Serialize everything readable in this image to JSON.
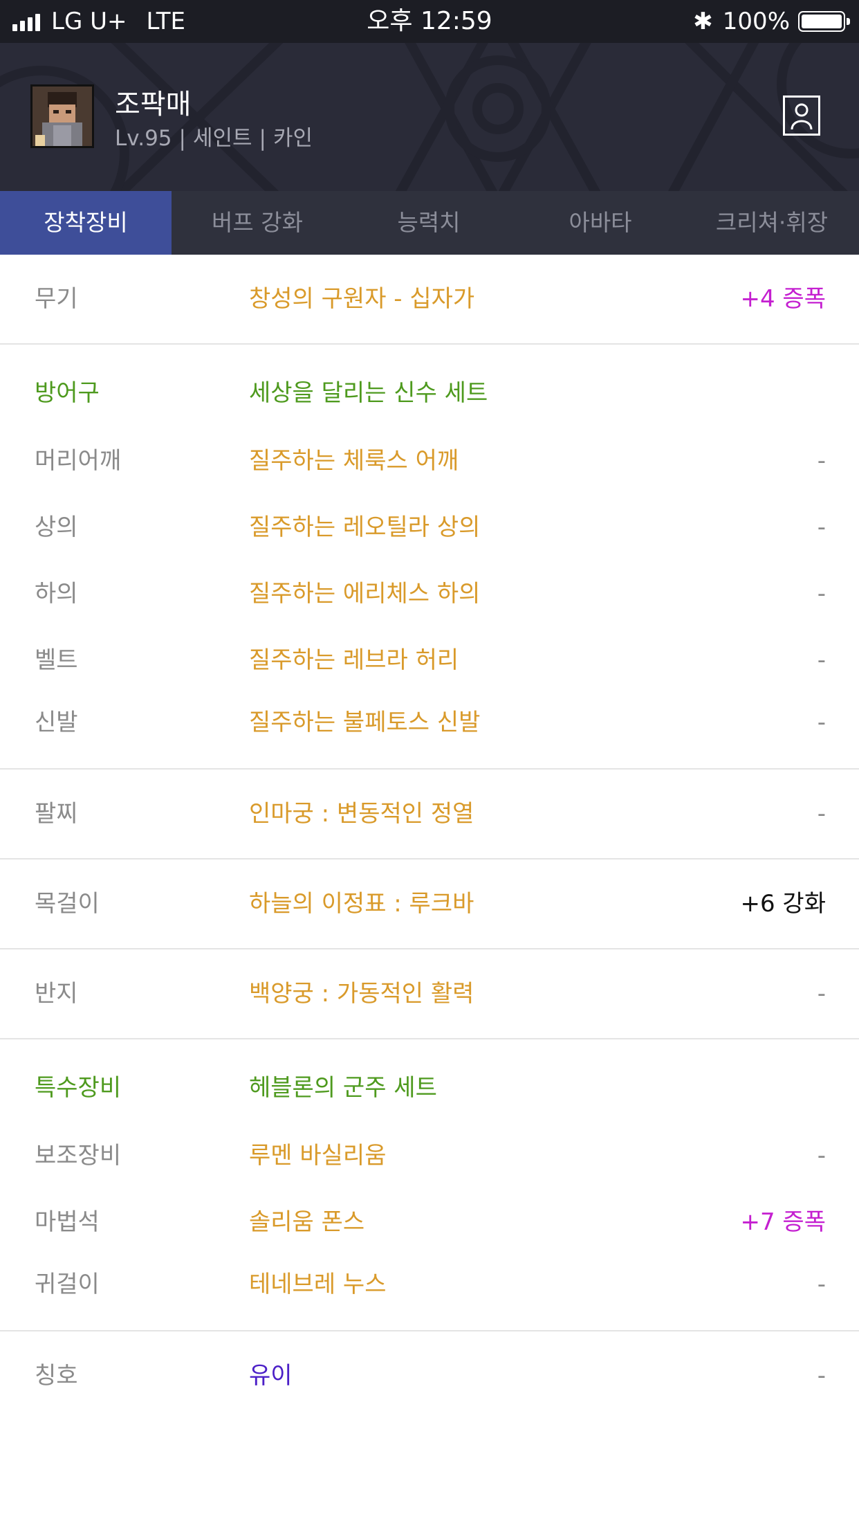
{
  "status_bar": {
    "carrier": "LG U+",
    "network": "LTE",
    "time": "오후 12:59",
    "battery": "100%",
    "icons": [
      "signal-icon",
      "bluetooth-icon",
      "battery-icon"
    ]
  },
  "profile": {
    "name": "조팍매",
    "level": "Lv.95",
    "server": "세인트",
    "job": "카인",
    "avatar_icon": "character-portrait",
    "profile_button_icon": "person-card-icon"
  },
  "tabs": [
    {
      "label": "장착장비",
      "active": true
    },
    {
      "label": "버프 강화",
      "active": false
    },
    {
      "label": "능력치",
      "active": false
    },
    {
      "label": "아바타",
      "active": false
    },
    {
      "label": "크리쳐·휘장",
      "active": false
    }
  ],
  "equipment": {
    "weapon": {
      "slot": "무기",
      "item": "창성의 구원자 - 십자가",
      "value": "+4 증폭"
    },
    "armor": {
      "header": {
        "slot": "방어구",
        "item": "세상을 달리는 신수 세트"
      },
      "items": [
        {
          "slot": "머리어깨",
          "item": "질주하는 체룩스 어깨",
          "value": "-"
        },
        {
          "slot": "상의",
          "item": "질주하는 레오틸라 상의",
          "value": "-"
        },
        {
          "slot": "하의",
          "item": "질주하는 에리체스 하의",
          "value": "-"
        },
        {
          "slot": "벨트",
          "item": "질주하는 레브라 허리",
          "value": "-"
        },
        {
          "slot": "신발",
          "item": "질주하는 불페토스 신발",
          "value": "-"
        }
      ]
    },
    "bracelet": {
      "slot": "팔찌",
      "item": "인마궁 : 변동적인 정열",
      "value": "-"
    },
    "necklace": {
      "slot": "목걸이",
      "item": "하늘의 이정표 : 루크바",
      "value": "+6 강화"
    },
    "ring": {
      "slot": "반지",
      "item": "백양궁 : 가동적인 활력",
      "value": "-"
    },
    "special": {
      "header": {
        "slot": "특수장비",
        "item": "헤블론의 군주 세트"
      },
      "items": [
        {
          "slot": "보조장비",
          "item": "루멘 바실리움",
          "value": "-"
        },
        {
          "slot": "마법석",
          "item": "솔리움 폰스",
          "value": "+7 증폭"
        },
        {
          "slot": "귀걸이",
          "item": "테네브레 누스",
          "value": "-"
        }
      ]
    },
    "title": {
      "slot": "칭호",
      "item": "유이",
      "value": "-"
    }
  },
  "colors": {
    "item_rare": "#d99a2a",
    "set_green": "#4e9a1e",
    "amplify": "#c41fd0",
    "title_purple": "#4b1fc7",
    "tab_active": "#3e4e99",
    "header_bg": "#2a2b38"
  }
}
